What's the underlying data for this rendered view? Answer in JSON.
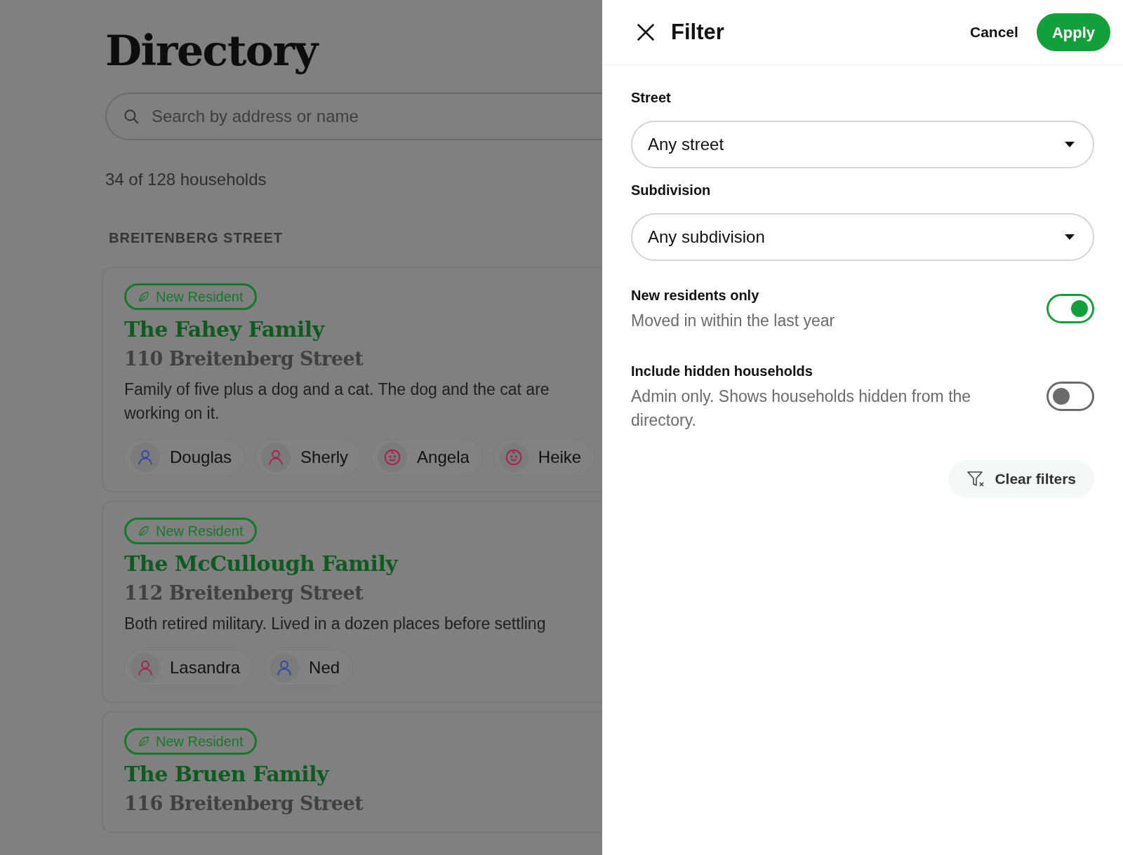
{
  "directory": {
    "title": "Directory",
    "search": {
      "placeholder": "Search by address or name"
    },
    "count": "34 of 128 households",
    "section": "BREITENBERG STREET",
    "households": [
      {
        "badge": "New Resident",
        "name": "The Fahey Family",
        "address": "110 Breitenberg Street",
        "description_lines": [
          "Family of five plus a dog and a cat. The dog and the cat are",
          "working on it."
        ],
        "members": [
          {
            "name": "Douglas",
            "kind": "adult",
            "color": "#2f47a8"
          },
          {
            "name": "Sherly",
            "kind": "adult",
            "color": "#a8224f"
          },
          {
            "name": "Angela",
            "kind": "child",
            "color": "#a8224f"
          },
          {
            "name": "Heike",
            "kind": "child",
            "color": "#a8224f"
          }
        ]
      },
      {
        "badge": "New Resident",
        "name": "The McCullough Family",
        "address": "112 Breitenberg Street",
        "description_lines": [
          "Both retired military. Lived in a dozen places before settling"
        ],
        "members": [
          {
            "name": "Lasandra",
            "kind": "adult",
            "color": "#a8224f"
          },
          {
            "name": "Ned",
            "kind": "adult",
            "color": "#2f47a8"
          }
        ]
      },
      {
        "badge": "New Resident",
        "name": "The Bruen Family",
        "address": "116 Breitenberg Street"
      }
    ]
  },
  "filter": {
    "title": "Filter",
    "cancel": "Cancel",
    "apply": "Apply",
    "selects": [
      {
        "label": "Street",
        "value": "Any street"
      },
      {
        "label": "Subdivision",
        "value": "Any subdivision"
      }
    ],
    "toggles": [
      {
        "label": "New residents only",
        "hint": "Moved in within the last year",
        "on": true
      },
      {
        "label": "Include hidden households",
        "hint": "Admin only. Shows households hidden from the directory.",
        "on": false
      }
    ],
    "clear": "Clear filters"
  }
}
